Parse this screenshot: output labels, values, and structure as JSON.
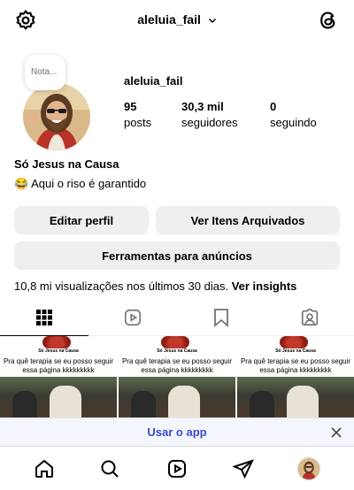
{
  "header": {
    "username": "aleluia_fail",
    "icons": [
      "settings-icon",
      "chevron-down-icon",
      "threads-icon"
    ]
  },
  "profile": {
    "note_label": "Nota...",
    "handle": "aleluia_fail",
    "stats": [
      {
        "value": "95",
        "label": "posts"
      },
      {
        "value": "30,3 mil",
        "label": "seguidores"
      },
      {
        "value": "0",
        "label": "seguindo"
      }
    ],
    "full_name": "Só Jesus na Causa",
    "bio": "😂 Aqui o riso é garantido"
  },
  "buttons": {
    "edit_profile": "Editar perfil",
    "archived": "Ver Itens Arquivados",
    "ad_tools": "Ferramentas para anúncios"
  },
  "insights": {
    "text": "10,8 mi visualizações nos últimos 30 dias.",
    "link": "Ver insights"
  },
  "tabs": [
    "grid-icon",
    "reels-icon",
    "saved-icon",
    "tagged-icon"
  ],
  "posts": [
    {
      "caption_top": "Só Jesus na Causa",
      "caption": "Pra quê terapia se eu posso seguir essa página kkkkkkkkk"
    },
    {
      "caption_top": "Só Jesus na Causa",
      "caption": "Pra quê terapia se eu posso seguir essa página kkkkkkkkk"
    },
    {
      "caption_top": "Só Jesus na Causa",
      "caption": "Pra quê terapia se eu posso seguir essa página kkkkkkkkk"
    }
  ],
  "app_banner": {
    "label": "Usar o app"
  },
  "bottom_nav": [
    "home-icon",
    "search-icon",
    "reels-icon",
    "direct-icon",
    "profile-avatar"
  ],
  "colors": {
    "button_bg": "#efefef",
    "link_blue": "#3a4bd0",
    "banner_bg": "#f3f6fc"
  }
}
